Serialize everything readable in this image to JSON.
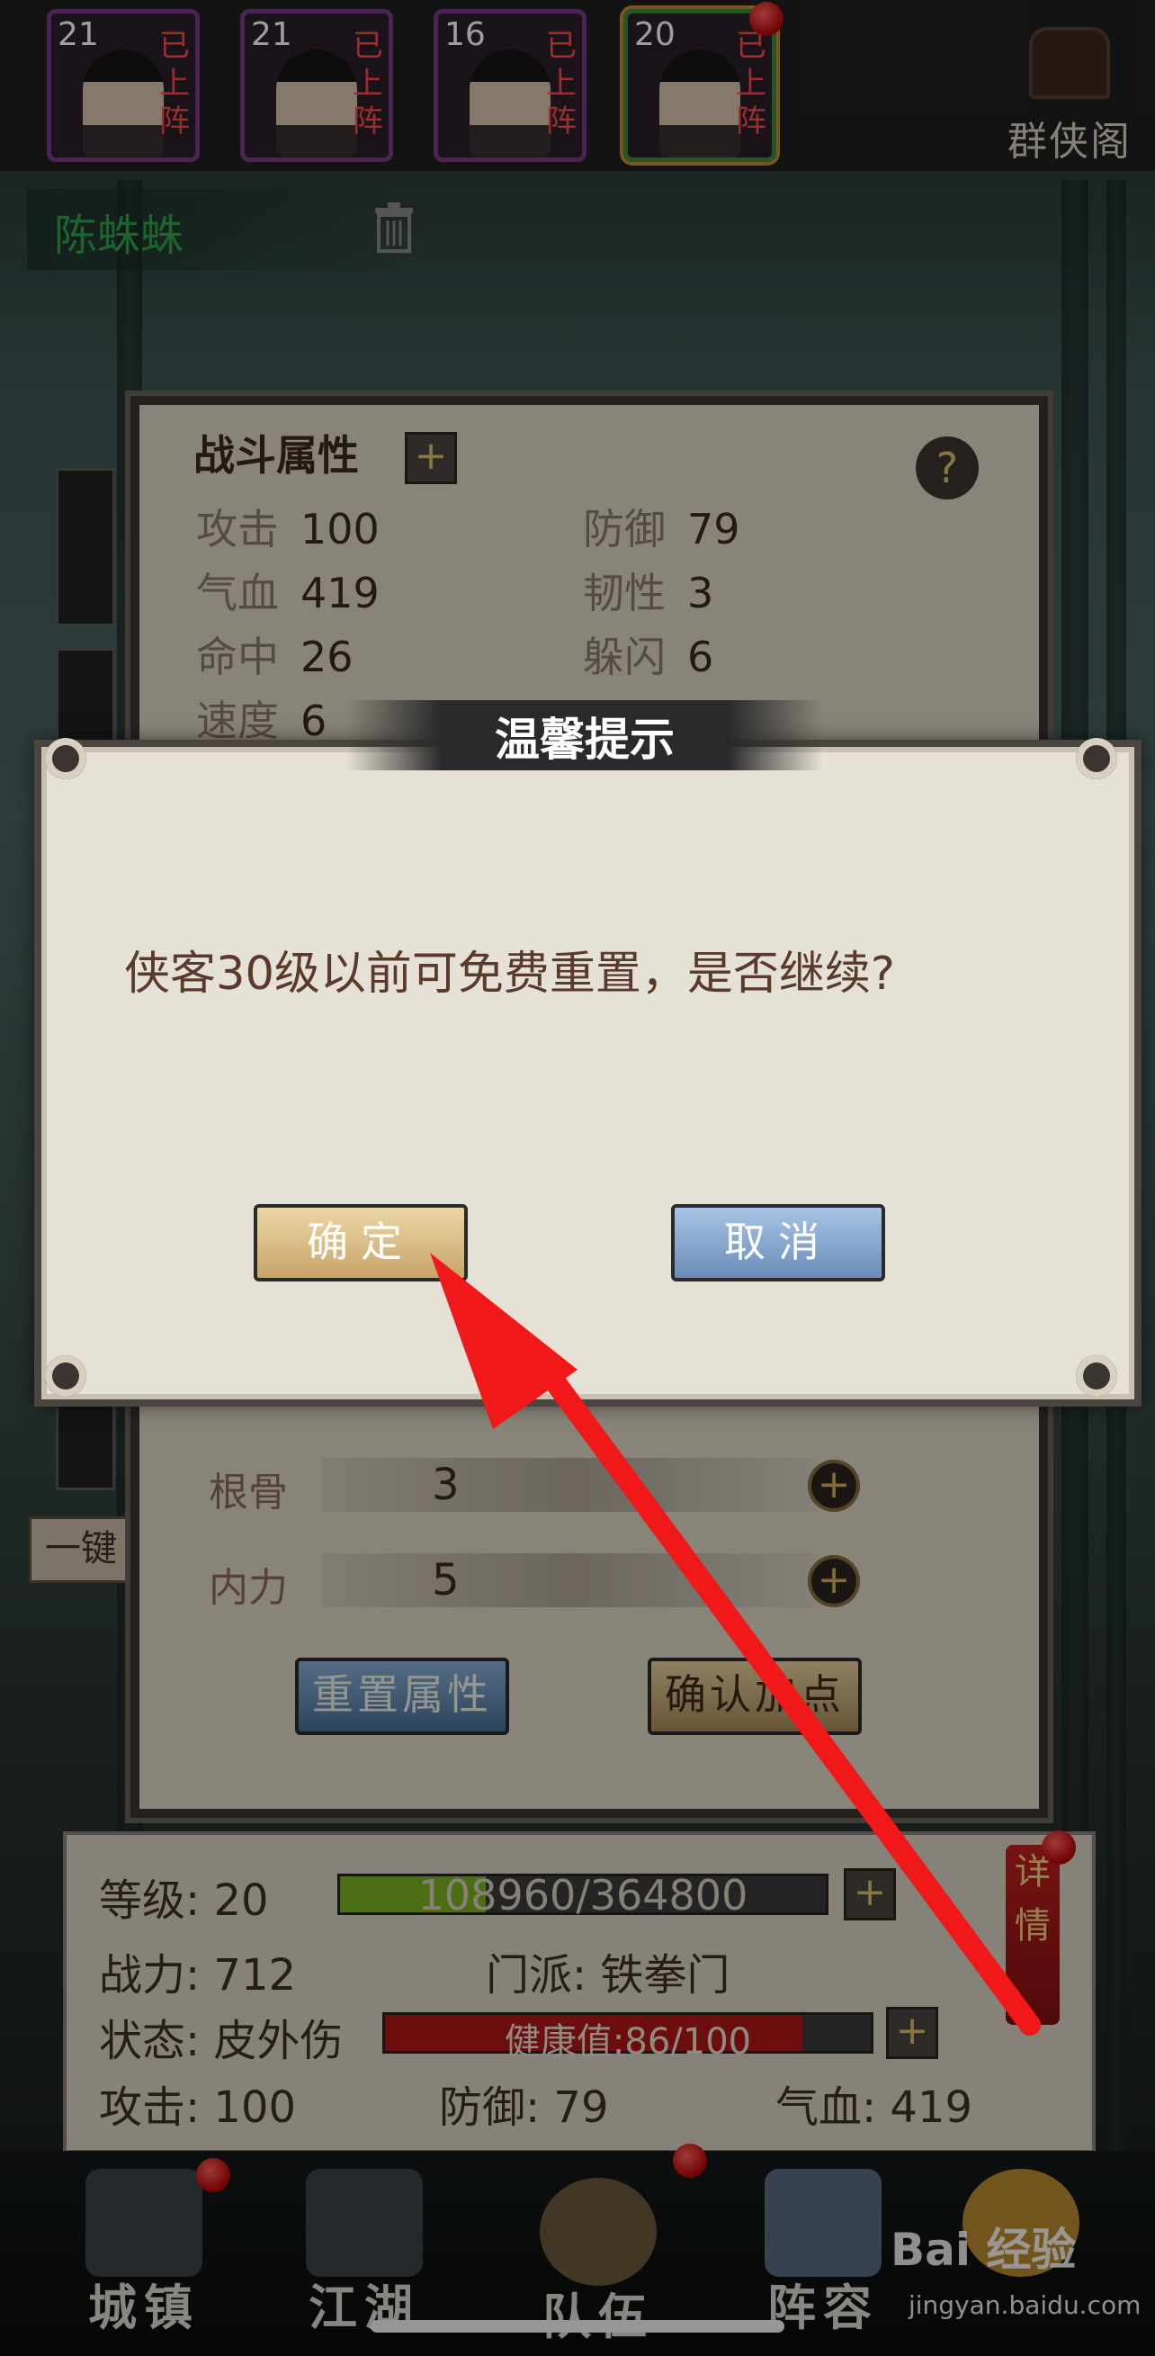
{
  "top_bar": {
    "heroes": [
      {
        "level": "21",
        "status": "已上阵"
      },
      {
        "level": "21",
        "status": "已上阵"
      },
      {
        "level": "16",
        "status": "已上阵"
      },
      {
        "level": "20",
        "status": "已上阵"
      }
    ],
    "pavilion_label": "群侠阁"
  },
  "hero_name": "陈蛛蛛",
  "combat_panel": {
    "title": "战斗属性",
    "stats": [
      {
        "key": "攻击",
        "value": "100"
      },
      {
        "key": "防御",
        "value": "79"
      },
      {
        "key": "气血",
        "value": "419"
      },
      {
        "key": "韧性",
        "value": "3"
      },
      {
        "key": "命中",
        "value": "26"
      },
      {
        "key": "躲闪",
        "value": "6"
      },
      {
        "key": "速度",
        "value": "6"
      }
    ],
    "points": [
      {
        "label": "根骨",
        "value": "3"
      },
      {
        "label": "内力",
        "value": "5"
      }
    ],
    "reset_button": "重置属性",
    "confirm_button": "确认加点"
  },
  "side_button": "一键",
  "info": {
    "level_label": "等级:",
    "level_value": "20",
    "exp": "108960/364800",
    "exp_fraction": 0.3,
    "power": "战力: 712",
    "sect": "门派: 铁拳门",
    "status": "状态: 皮外伤",
    "health": "健康值:86/100",
    "health_fraction": 0.86,
    "attack": "攻击: 100",
    "defense": "防御: 79",
    "hp": "气血: 419",
    "detail": "详情"
  },
  "nav": [
    {
      "label": "城镇"
    },
    {
      "label": "江湖"
    },
    {
      "label": "队伍"
    },
    {
      "label": "阵容"
    }
  ],
  "modal": {
    "title": "温馨提示",
    "message": "侠客30级以前可免费重置，是否继续?",
    "ok": "确定",
    "cancel": "取消"
  },
  "watermark": {
    "text": "Bai 经验",
    "sub": "jingyan.baidu.com"
  },
  "colors": {
    "accent_red": "#ff2020",
    "ok_button": "#e6c88a",
    "cancel_button": "#8fb0d8",
    "hero_name": "#2aa54a"
  }
}
